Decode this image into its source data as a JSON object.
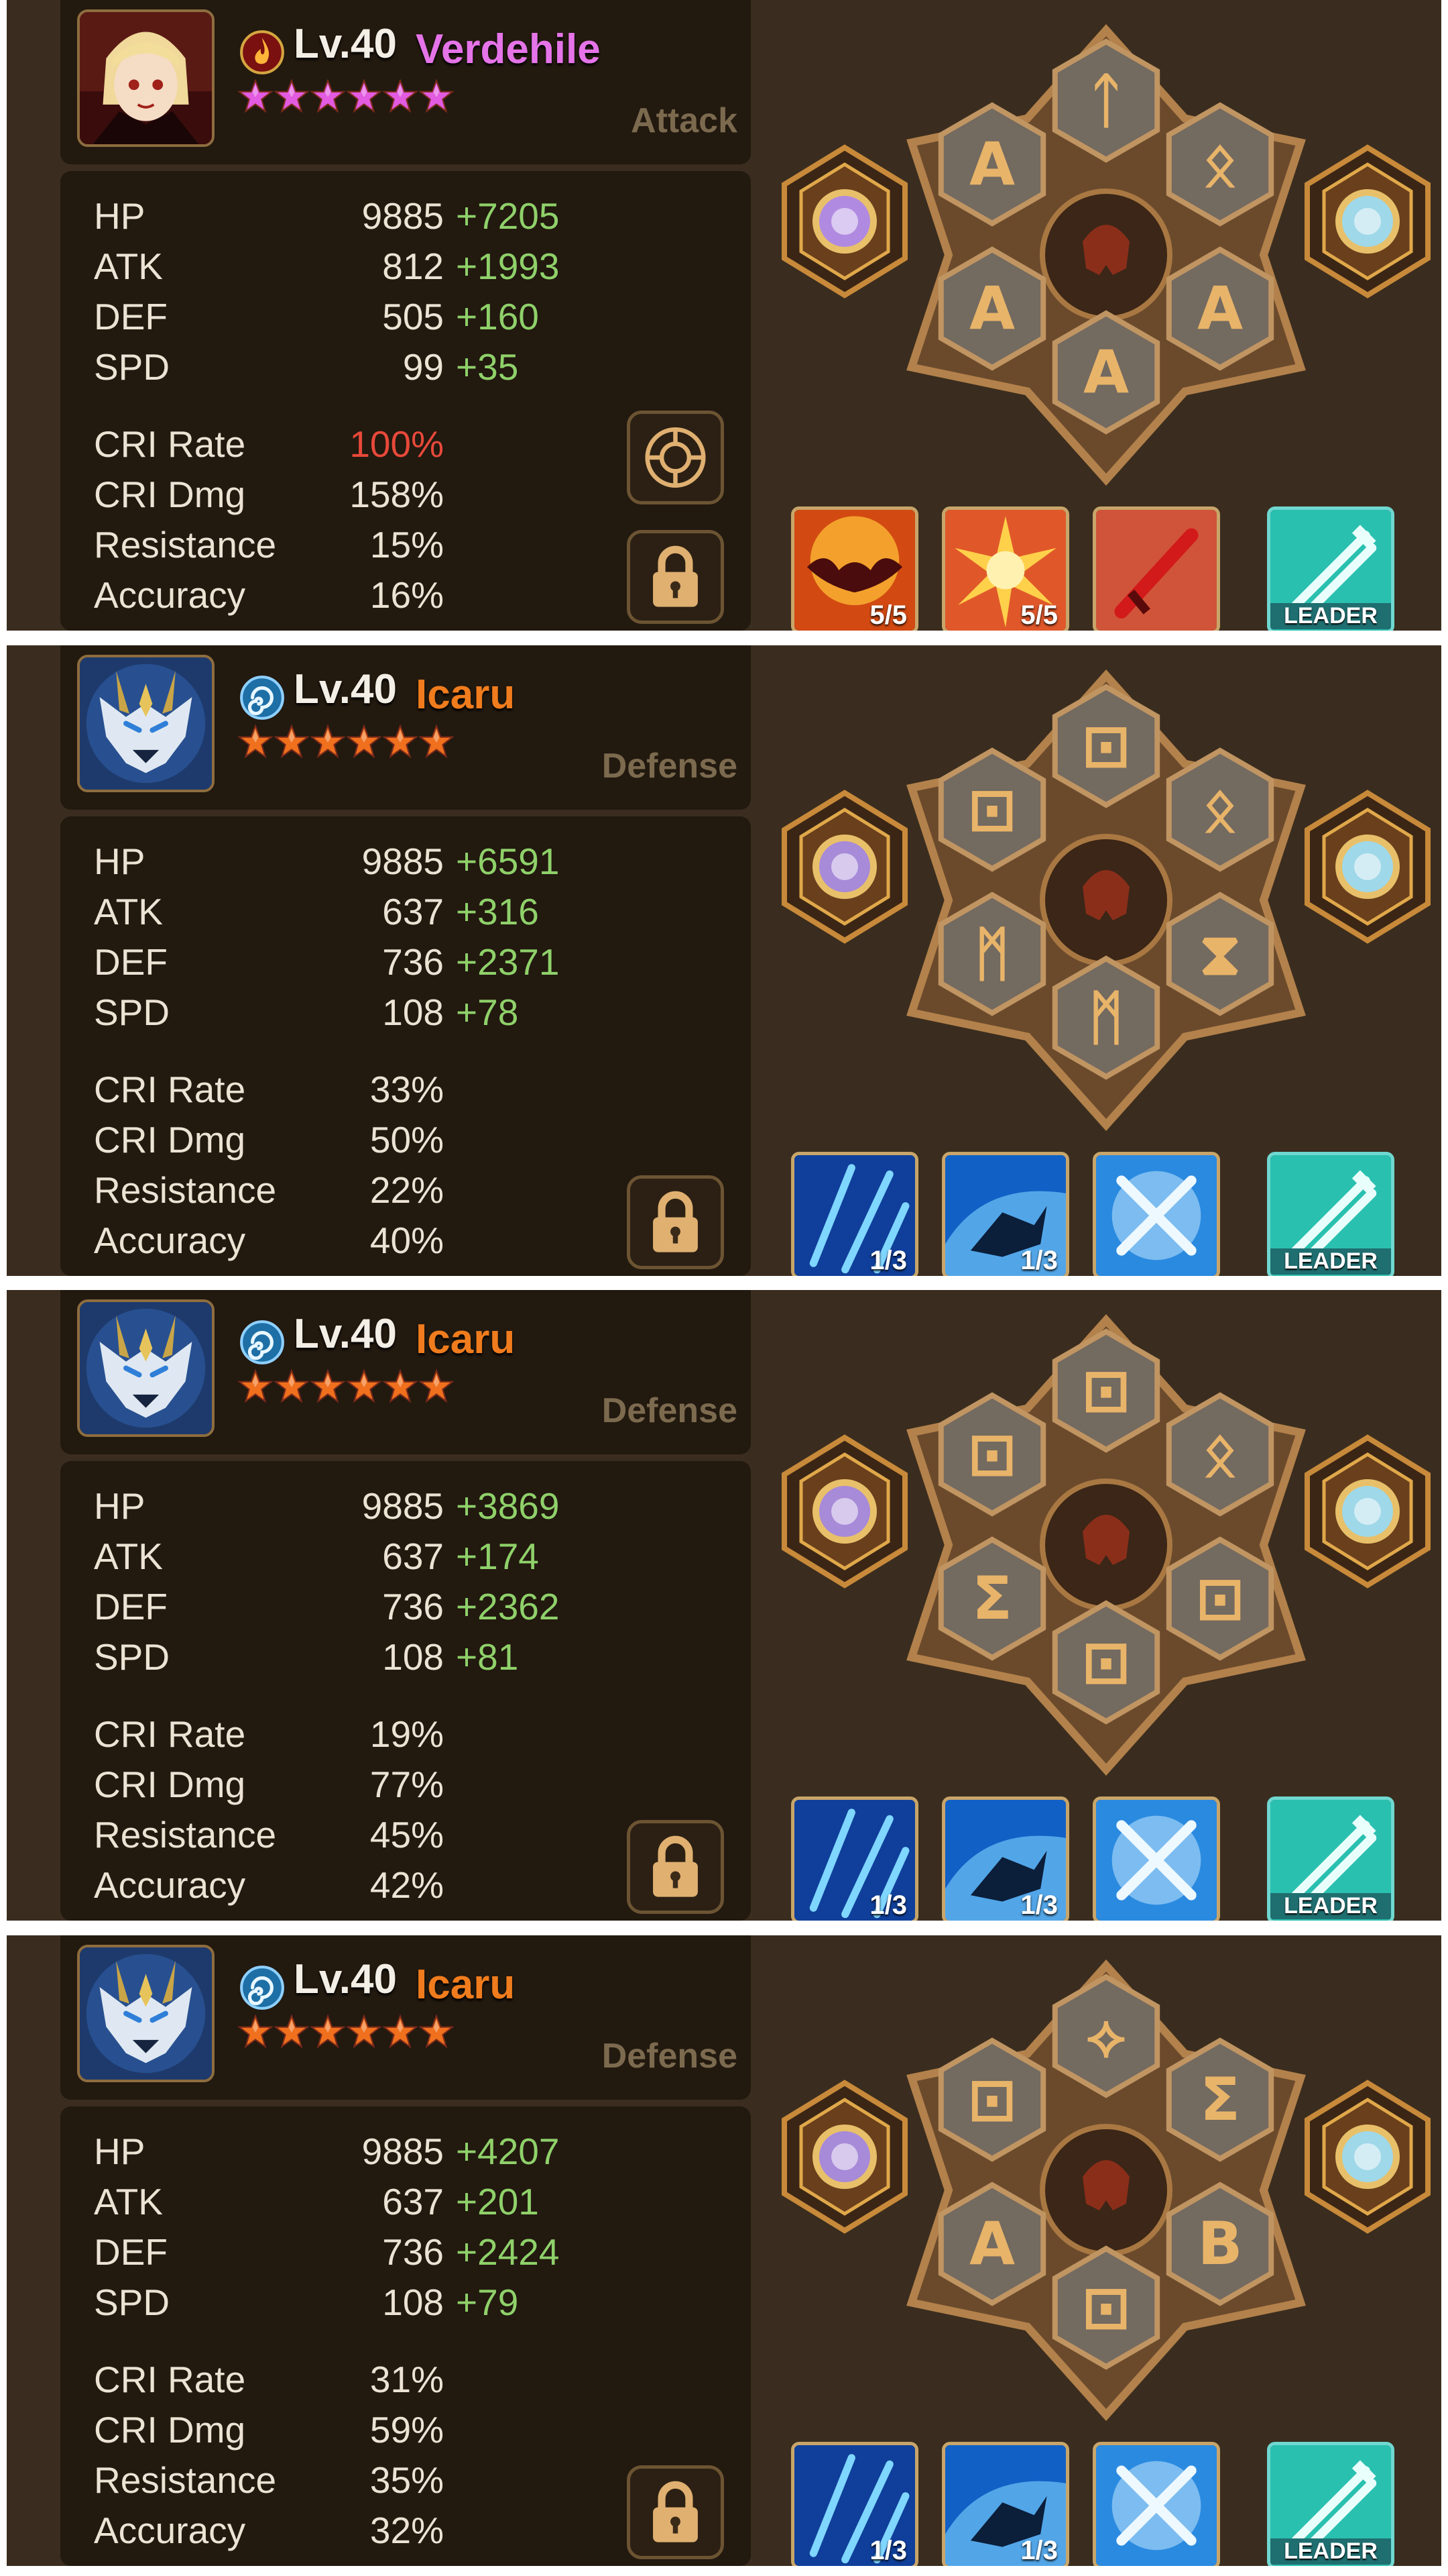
{
  "monsters": [
    {
      "level": "Lv.40",
      "name": "Verdehile",
      "name_color": "#e574e8",
      "element": "fire",
      "role": "Attack",
      "star_color": "#e25be0",
      "portrait": "vampire-portrait",
      "stats": [
        {
          "label": "HP",
          "value": "9885",
          "bonus": "+7205"
        },
        {
          "label": "ATK",
          "value": "812",
          "bonus": "+1993"
        },
        {
          "label": "DEF",
          "value": "505",
          "bonus": "+160"
        },
        {
          "label": "SPD",
          "value": "99",
          "bonus": "+35"
        }
      ],
      "sub_stats": [
        {
          "label": "CRI Rate",
          "value": "100%",
          "color": "#e8493a"
        },
        {
          "label": "CRI Dmg",
          "value": "158%"
        },
        {
          "label": "Resistance",
          "value": "15%"
        },
        {
          "label": "Accuracy",
          "value": "16%"
        }
      ],
      "rune_glyphs": [
        "ᛏ",
        "ᛟ",
        "A",
        "A",
        "A",
        "A"
      ],
      "artifacts": [
        "fire-attribute-artifact",
        "type-artifact"
      ],
      "skills": [
        {
          "icon": "bat-skill-icon",
          "level": "5/5",
          "theme": "fire"
        },
        {
          "icon": "burst-skill-icon",
          "level": "5/5",
          "theme": "fire"
        },
        {
          "icon": "sword-skill-icon",
          "level": "",
          "theme": "fire"
        },
        {
          "icon": "leader-skill-icon",
          "level": "LEADER",
          "theme": "leader"
        }
      ]
    },
    {
      "level": "Lv.40",
      "name": "Icaru",
      "name_color": "#f07c1d",
      "element": "water",
      "role": "Defense",
      "star_color": "#f0701d",
      "portrait": "wolf-portrait",
      "stats": [
        {
          "label": "HP",
          "value": "9885",
          "bonus": "+6591"
        },
        {
          "label": "ATK",
          "value": "637",
          "bonus": "+316"
        },
        {
          "label": "DEF",
          "value": "736",
          "bonus": "+2371"
        },
        {
          "label": "SPD",
          "value": "108",
          "bonus": "+78"
        }
      ],
      "sub_stats": [
        {
          "label": "CRI Rate",
          "value": "33%"
        },
        {
          "label": "CRI Dmg",
          "value": "50%"
        },
        {
          "label": "Resistance",
          "value": "22%"
        },
        {
          "label": "Accuracy",
          "value": "40%"
        }
      ],
      "rune_glyphs": [
        "⊡",
        "ᛟ",
        "⊡",
        "⧗",
        "ᛗ",
        "ᛗ"
      ],
      "artifacts": [
        "water-attribute-artifact",
        "type-artifact"
      ],
      "skills": [
        {
          "icon": "ice-slash-skill-icon",
          "level": "1/3",
          "theme": "water"
        },
        {
          "icon": "wolf-skill-icon",
          "level": "1/3",
          "theme": "water"
        },
        {
          "icon": "cross-sword-skill-icon",
          "level": "",
          "theme": "water"
        },
        {
          "icon": "leader-skill-icon",
          "level": "LEADER",
          "theme": "leader"
        }
      ]
    },
    {
      "level": "Lv.40",
      "name": "Icaru",
      "name_color": "#f07c1d",
      "element": "water",
      "role": "Defense",
      "star_color": "#f0701d",
      "portrait": "wolf-portrait",
      "stats": [
        {
          "label": "HP",
          "value": "9885",
          "bonus": "+3869"
        },
        {
          "label": "ATK",
          "value": "637",
          "bonus": "+174"
        },
        {
          "label": "DEF",
          "value": "736",
          "bonus": "+2362"
        },
        {
          "label": "SPD",
          "value": "108",
          "bonus": "+81"
        }
      ],
      "sub_stats": [
        {
          "label": "CRI Rate",
          "value": "19%"
        },
        {
          "label": "CRI Dmg",
          "value": "77%"
        },
        {
          "label": "Resistance",
          "value": "45%"
        },
        {
          "label": "Accuracy",
          "value": "42%"
        }
      ],
      "rune_glyphs": [
        "⊡",
        "ᛟ",
        "⊡",
        "⊡",
        "Σ",
        "⊡"
      ],
      "artifacts": [
        "water-attribute-artifact",
        "type-artifact"
      ],
      "skills": [
        {
          "icon": "ice-slash-skill-icon",
          "level": "1/3",
          "theme": "water"
        },
        {
          "icon": "wolf-skill-icon",
          "level": "1/3",
          "theme": "water"
        },
        {
          "icon": "cross-sword-skill-icon",
          "level": "",
          "theme": "water"
        },
        {
          "icon": "leader-skill-icon",
          "level": "LEADER",
          "theme": "leader"
        }
      ]
    },
    {
      "level": "Lv.40",
      "name": "Icaru",
      "name_color": "#f07c1d",
      "element": "water",
      "role": "Defense",
      "star_color": "#f0701d",
      "portrait": "wolf-portrait",
      "stats": [
        {
          "label": "HP",
          "value": "9885",
          "bonus": "+4207"
        },
        {
          "label": "ATK",
          "value": "637",
          "bonus": "+201"
        },
        {
          "label": "DEF",
          "value": "736",
          "bonus": "+2424"
        },
        {
          "label": "SPD",
          "value": "108",
          "bonus": "+79"
        }
      ],
      "sub_stats": [
        {
          "label": "CRI Rate",
          "value": "31%"
        },
        {
          "label": "CRI Dmg",
          "value": "59%"
        },
        {
          "label": "Resistance",
          "value": "35%"
        },
        {
          "label": "Accuracy",
          "value": "32%"
        }
      ],
      "rune_glyphs": [
        "⟡",
        "Σ",
        "⊡",
        "B",
        "A",
        "⊡"
      ],
      "artifacts": [
        "water-attribute-artifact",
        "type-artifact"
      ],
      "skills": [
        {
          "icon": "ice-slash-skill-icon",
          "level": "1/3",
          "theme": "water"
        },
        {
          "icon": "wolf-skill-icon",
          "level": "1/3",
          "theme": "water"
        },
        {
          "icon": "cross-sword-skill-icon",
          "level": "",
          "theme": "water"
        },
        {
          "icon": "leader-skill-icon",
          "level": "LEADER",
          "theme": "leader"
        }
      ]
    }
  ]
}
